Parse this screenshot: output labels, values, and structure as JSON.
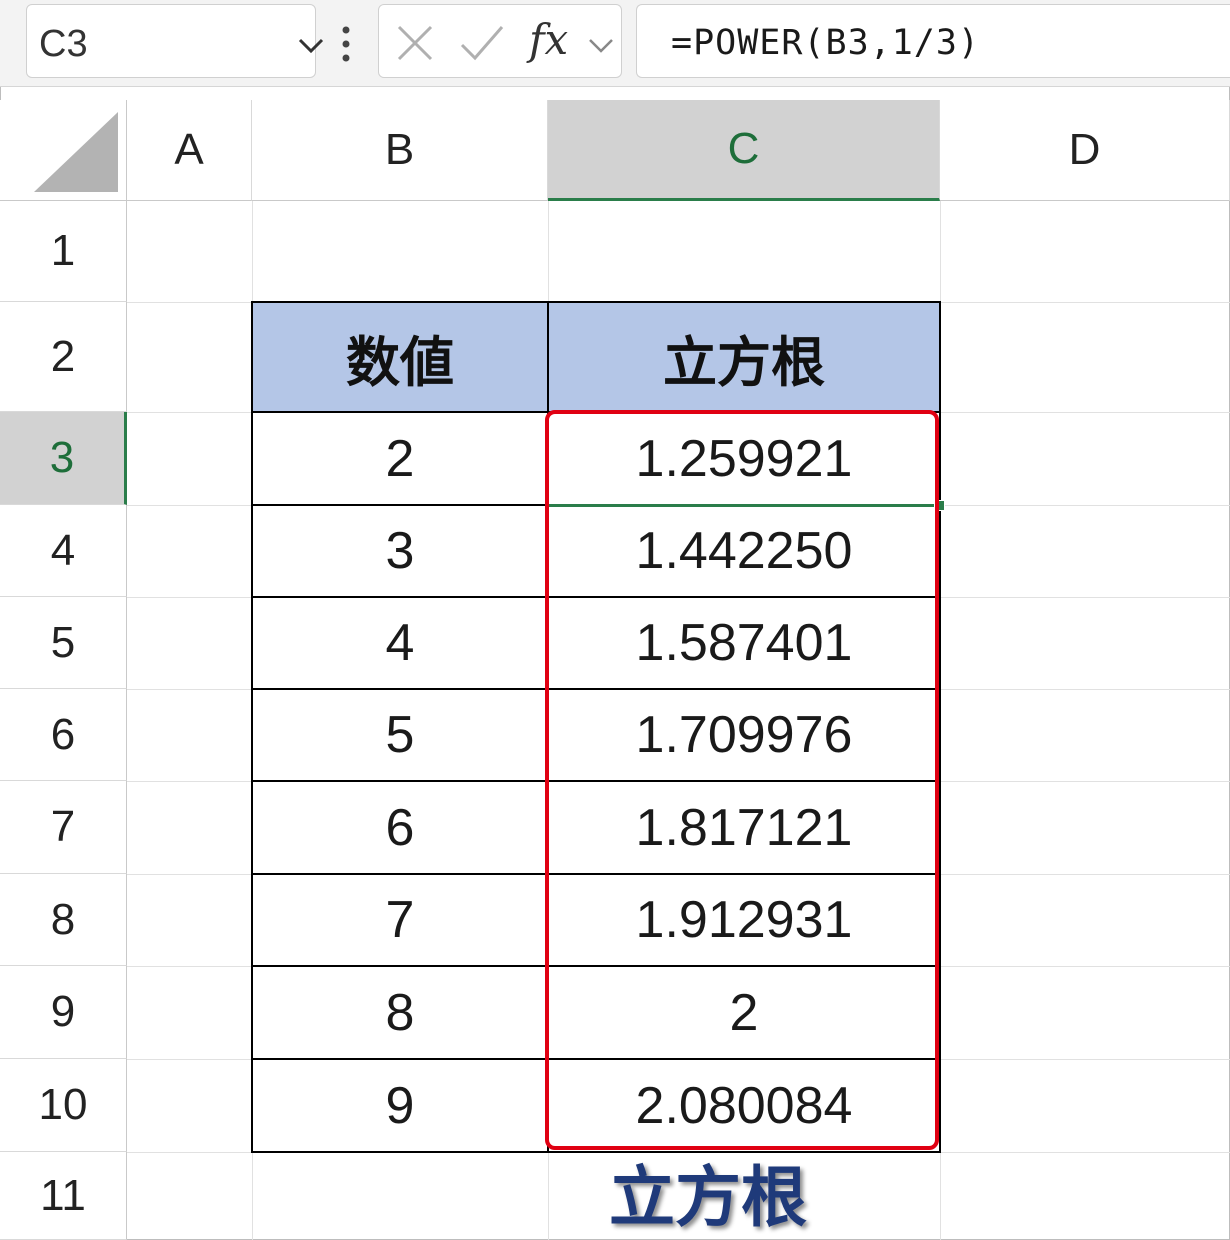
{
  "formula_bar": {
    "name_box": "C3",
    "fx_label": "fx",
    "formula": "=POWER(B3,1/3)"
  },
  "columns": [
    "A",
    "B",
    "C",
    "D"
  ],
  "selected_column": "C",
  "rows": [
    "1",
    "2",
    "3",
    "4",
    "5",
    "6",
    "7",
    "8",
    "9",
    "10",
    "11"
  ],
  "selected_row": "3",
  "table": {
    "headers": [
      "数値",
      "立方根"
    ],
    "rows": [
      [
        "2",
        "1.259921"
      ],
      [
        "3",
        "1.442250"
      ],
      [
        "4",
        "1.587401"
      ],
      [
        "5",
        "1.709976"
      ],
      [
        "6",
        "1.817121"
      ],
      [
        "7",
        "1.912931"
      ],
      [
        "8",
        "2"
      ],
      [
        "9",
        "2.080084"
      ]
    ]
  },
  "caption": "立方根",
  "colors": {
    "header_fill": "#b4c6e7",
    "highlight_border": "#e00012",
    "selection_green": "#2a7d4a",
    "caption_text": "#1f3a7a"
  }
}
